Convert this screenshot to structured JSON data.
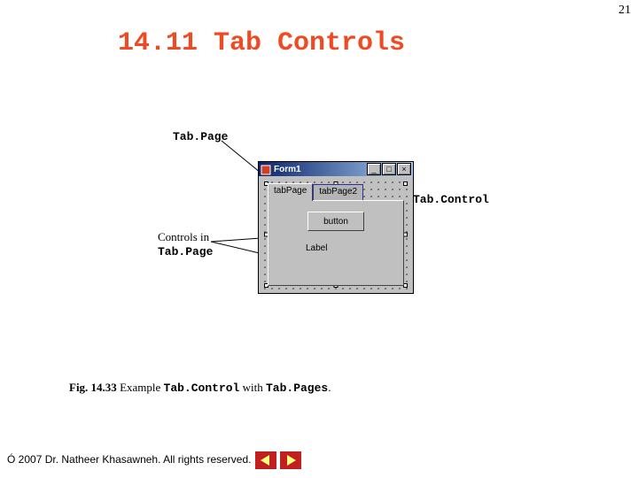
{
  "page_number": "21",
  "section_title": "14.11 Tab Controls",
  "callouts": {
    "tabpage": "Tab.Page",
    "tabcontrol": "Tab.Control",
    "controls_in_line1": "Controls in",
    "controls_in_line2": "Tab.Page"
  },
  "window": {
    "title": "Form1",
    "tabs": [
      "tabPage",
      "tabPage2"
    ],
    "button_label": "button",
    "label_text": "Label"
  },
  "caption": {
    "fig": "Fig. 14.33",
    "mid1": " Example ",
    "mono1": "Tab.Control",
    "mid2": " with ",
    "mono2": "Tab.Pages",
    "tail": "."
  },
  "footer": "Ó 2007 Dr. Natheer Khasawneh. All rights reserved."
}
